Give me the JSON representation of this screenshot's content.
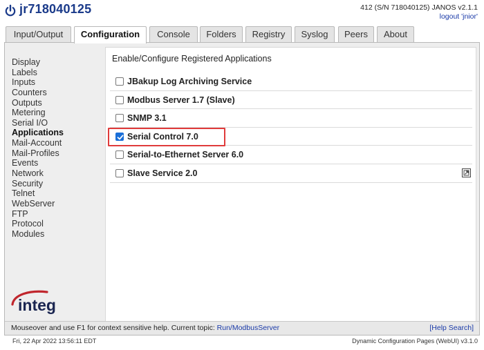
{
  "header": {
    "unit_name": "jr718040125",
    "unit_info": "412 (S/N 718040125) JANOS v2.1.1",
    "logout_text": "logout 'jnior'"
  },
  "tabs": [
    {
      "label": "Input/Output",
      "active": false
    },
    {
      "label": "Configuration",
      "active": true
    },
    {
      "label": "Console",
      "active": false
    },
    {
      "label": "Folders",
      "active": false
    },
    {
      "label": "Registry",
      "active": false
    },
    {
      "label": "Syslog",
      "active": false
    },
    {
      "label": "Peers",
      "active": false
    },
    {
      "label": "About",
      "active": false
    }
  ],
  "sidebar": {
    "items": [
      {
        "label": "Display"
      },
      {
        "label": "Labels"
      },
      {
        "label": "Inputs"
      },
      {
        "label": "Counters"
      },
      {
        "label": "Outputs"
      },
      {
        "label": "Metering"
      },
      {
        "label": "Serial I/O"
      },
      {
        "label": "Applications",
        "active": true
      },
      {
        "label": "Mail-Account"
      },
      {
        "label": "Mail-Profiles"
      },
      {
        "label": "Events"
      },
      {
        "label": "Network"
      },
      {
        "label": "Security"
      },
      {
        "label": "Telnet"
      },
      {
        "label": "WebServer"
      },
      {
        "label": "FTP"
      },
      {
        "label": "Protocol"
      },
      {
        "label": "Modules"
      }
    ],
    "logo_text": "integ"
  },
  "panel": {
    "title": "Enable/Configure Registered Applications",
    "apps": [
      {
        "label": "JBakup Log Archiving Service",
        "checked": false
      },
      {
        "label": "Modbus Server 1.7 (Slave)",
        "checked": false
      },
      {
        "label": "SNMP 3.1",
        "checked": false
      },
      {
        "label": "Serial Control 7.0",
        "checked": true,
        "highlighted": true
      },
      {
        "label": "Serial-to-Ethernet Server 6.0",
        "checked": false
      },
      {
        "label": "Slave Service 2.0",
        "checked": false,
        "icon": "external-link-icon"
      }
    ]
  },
  "helpbar": {
    "text": "Mouseover and use F1 for context sensitive help. Current topic: ",
    "topic": "Run/ModbusServer",
    "search_label": "[Help Search]"
  },
  "footer": {
    "datetime": "Fri, 22 Apr 2022 13:56:11 EDT",
    "version": "Dynamic Configuration Pages (WebUI) v3.1.0"
  },
  "colors": {
    "title_blue": "#1a3a8a",
    "link_blue": "#1a3aa8",
    "checkbox_blue": "#1a6fd8",
    "highlight_red": "#e03a3a",
    "logo_red": "#c0262d"
  }
}
